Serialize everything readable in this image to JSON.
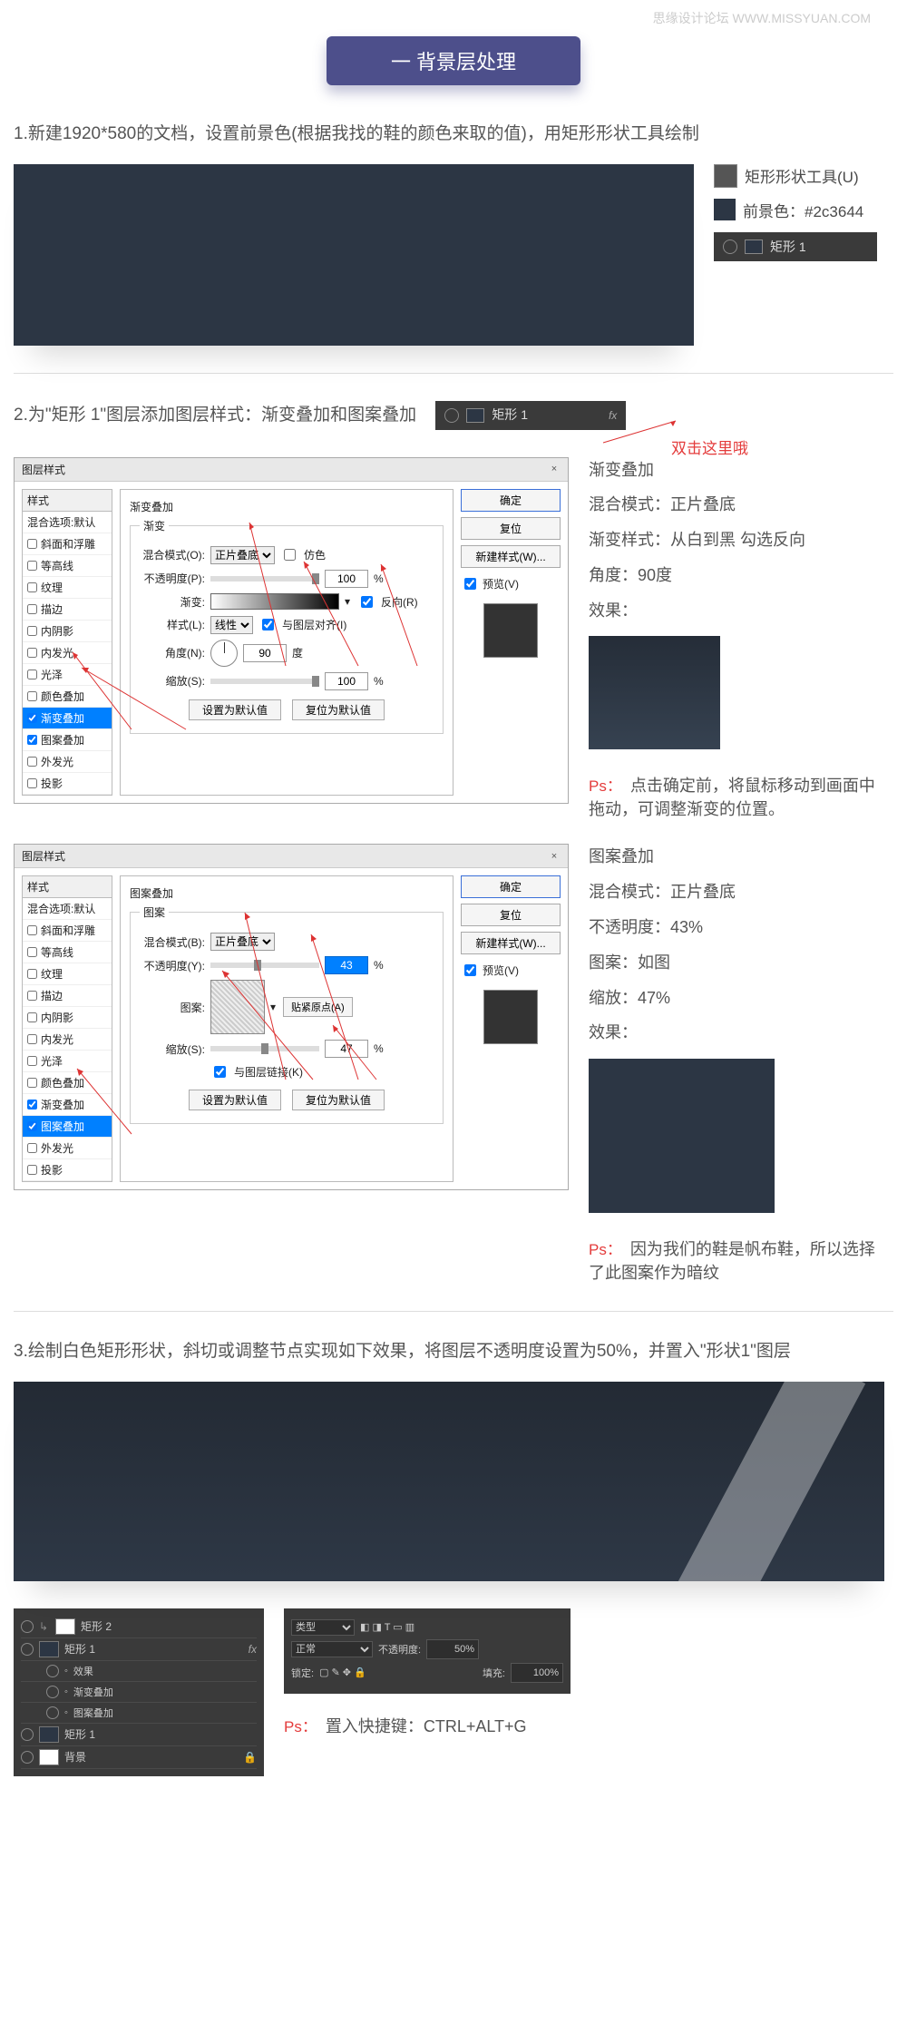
{
  "watermark": "思缘设计论坛  WWW.MISSYUAN.COM",
  "section_title": "一  背景层处理",
  "step1_text": "1.新建1920*580的文档，设置前景色(根据我找的鞋的颜色来取的值)，用矩形形状工具绘制",
  "tool_label": "矩形形状工具(U)",
  "fg_label": "前景色：#2c3644",
  "layer_rect1": "矩形 1",
  "step2_text": "2.为\"矩形 1\"图层添加图层样式：渐变叠加和图案叠加",
  "dbl_click_hint": "双击这里哦",
  "ls_title": "图层样式",
  "ls_close_label": "×",
  "ls_left": {
    "header": "样式",
    "blend_defaults": "混合选项:默认",
    "opts": {
      "bevel": "斜面和浮雕",
      "contour": "等高线",
      "texture": "纹理",
      "stroke": "描边",
      "inner_shadow": "内阴影",
      "inner_glow": "内发光",
      "satin": "光泽",
      "color_overlay": "颜色叠加",
      "gradient_overlay": "渐变叠加",
      "pattern_overlay": "图案叠加",
      "outer_glow": "外发光",
      "drop_shadow": "投影"
    }
  },
  "ls_grad": {
    "group_title": "渐变叠加",
    "subgroup": "渐变",
    "blend_mode_lbl": "混合模式(O):",
    "blend_mode_val": "正片叠底",
    "dither_lbl": "仿色",
    "opacity_lbl": "不透明度(P):",
    "opacity_val": "100",
    "pct": "%",
    "gradient_lbl": "渐变:",
    "reverse_lbl": "反向(R)",
    "style_lbl": "样式(L):",
    "style_val": "线性",
    "align_lbl": "与图层对齐(I)",
    "angle_lbl": "角度(N):",
    "angle_val": "90",
    "deg": "度",
    "scale_lbl": "缩放(S):",
    "scale_val": "100",
    "btn_default": "设置为默认值",
    "btn_reset": "复位为默认值"
  },
  "ls_pat": {
    "group_title": "图案叠加",
    "subgroup": "图案",
    "blend_mode_lbl": "混合模式(B):",
    "blend_mode_val": "正片叠底",
    "opacity_lbl": "不透明度(Y):",
    "opacity_val": "43",
    "pct": "%",
    "pattern_lbl": "图案:",
    "snap_lbl": "贴紧原点(A)",
    "scale_lbl": "缩放(S):",
    "scale_val": "47",
    "link_lbl": "与图层链接(K)",
    "btn_default": "设置为默认值",
    "btn_reset": "复位为默认值"
  },
  "ls_right": {
    "ok": "确定",
    "reset": "复位",
    "new_style": "新建样式(W)...",
    "preview": "预览(V)"
  },
  "right_grad": {
    "title": "渐变叠加",
    "l1": "混合模式：正片叠底",
    "l2": "渐变样式：从白到黑  勾选反向",
    "l3": "角度：90度",
    "l4": "效果：",
    "ps_label": "Ps：",
    "ps_body": "点击确定前，将鼠标移动到画面中拖动，可调整渐变的位置。"
  },
  "right_pat": {
    "title": "图案叠加",
    "l1": "混合模式：正片叠底",
    "l2": "不透明度：43%",
    "l3": "图案：如图",
    "l4": "缩放：47%",
    "l5": "效果：",
    "ps_label": "Ps：",
    "ps_body": "因为我们的鞋是帆布鞋，所以选择了此图案作为暗纹"
  },
  "step3_text": "3.绘制白色矩形形状，斜切或调整节点实现如下效果，将图层不透明度设置为50%，并置入\"形状1\"图层",
  "layers_panel": {
    "l1": "矩形 2",
    "l2": "矩形 1",
    "fx": "fx",
    "sub0": "效果",
    "sub1": "渐变叠加",
    "sub2": "图案叠加",
    "l3": "矩形 1",
    "l4": "背景"
  },
  "props_panel": {
    "kind": "类型",
    "normal": "正常",
    "opacity_lbl": "不透明度:",
    "opacity_val": "50%",
    "lock_lbl": "锁定:",
    "fill_lbl": "填充:",
    "fill_val": "100%"
  },
  "ps3_label": "Ps：",
  "ps3_body": "置入快捷键：CTRL+ALT+G"
}
